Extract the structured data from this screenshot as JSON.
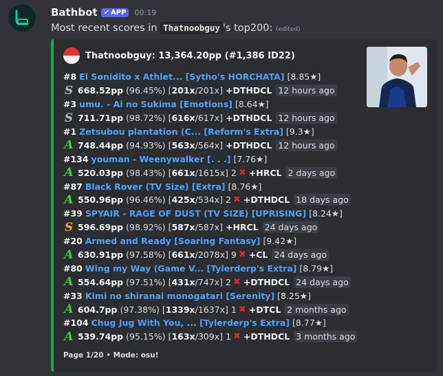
{
  "message": {
    "username": "Bathbot",
    "badge": "APP",
    "badge_check": "✔",
    "timestamp": "00:19",
    "content_prefix": "Most recent scores in ",
    "content_code": "Thatnoobguy",
    "content_suffix": "'s top200:",
    "edited": "(edited)"
  },
  "colors": {
    "embed_accent": "#1fa84a",
    "link": "#4aa3ff",
    "grade_S": "#b6b6c6",
    "grade_A": "#3ccf3c",
    "grade_S_gold": "#f2a43c",
    "miss": "#e5232b"
  },
  "embed": {
    "author": "Thatnoobguy: 13,364.20pp (#1,386 ID22)",
    "flag_icon": "indonesia-flag-icon",
    "footer": "Page 1/20 • Mode: osu!",
    "scores": [
      {
        "rank": "#8",
        "map": "El Sonidito x Athlet... [Sytho's HORCHATA]",
        "stars": "[8.85★]",
        "grade": "S",
        "grade_style": "silver",
        "pp": "668.52pp",
        "acc": "(96.45%)",
        "combo": "201x",
        "max_combo": "/201x]",
        "misses": "",
        "mods": "+DTHDCL",
        "ago": "12 hours ago"
      },
      {
        "rank": "#3",
        "map": "umu. - Ai no Sukima [Emotions]",
        "stars": "[8.64★]",
        "grade": "S",
        "grade_style": "silver",
        "pp": "711.71pp",
        "acc": "(98.72%)",
        "combo": "616x",
        "max_combo": "/617x]",
        "misses": "",
        "mods": "+DTHDCL",
        "ago": "12 hours ago"
      },
      {
        "rank": "#1",
        "map": "Zetsubou plantation (C... [Reform's Extra]",
        "stars": "[9.3★]",
        "grade": "A",
        "grade_style": "green",
        "pp": "748.44pp",
        "acc": "(94.93%)",
        "combo": "563x",
        "max_combo": "/564x]",
        "misses": "",
        "mods": "+DTHDCL",
        "ago": "12 hours ago"
      },
      {
        "rank": "#134",
        "map": "youman - Weenywalker [. . .]",
        "stars": "[7.76★]",
        "grade": "A",
        "grade_style": "green",
        "pp": "520.03pp",
        "acc": "(98.43%)",
        "combo": "661x",
        "max_combo": "/1615x]",
        "misses": "2",
        "mods": "+HRCL",
        "ago": "2 days ago"
      },
      {
        "rank": "#87",
        "map": "Black Rover (TV Size) [Extra]",
        "stars": "[8.76★]",
        "grade": "A",
        "grade_style": "green",
        "pp": "550.96pp",
        "acc": "(96.46%)",
        "combo": "425x",
        "max_combo": "/534x]",
        "misses": "2",
        "mods": "+DTHDCL",
        "ago": "18 days ago"
      },
      {
        "rank": "#39",
        "map": "SPYAIR - RAGE OF DUST (TV SIZE) [UPRISING]",
        "stars": "[8.24★]",
        "grade": "S",
        "grade_style": "gold",
        "pp": "596.69pp",
        "acc": "(98.92%)",
        "combo": "587x",
        "max_combo": "/587x]",
        "misses": "",
        "mods": "+HRCL",
        "ago": "24 days ago"
      },
      {
        "rank": "#20",
        "map": "Armed and Ready [Soaring Fantasy]",
        "stars": "[9.42★]",
        "grade": "A",
        "grade_style": "green",
        "pp": "630.91pp",
        "acc": "(97.58%)",
        "combo": "661x",
        "max_combo": "/2078x]",
        "misses": "9",
        "mods": "+CL",
        "ago": "24 days ago"
      },
      {
        "rank": "#80",
        "map": "Wing my Way (Game V... [Tylerderp's Extra]",
        "stars": "[8.79★]",
        "grade": "A",
        "grade_style": "green",
        "pp": "554.64pp",
        "acc": "(97.51%)",
        "combo": "431x",
        "max_combo": "/747x]",
        "misses": "2",
        "mods": "+DTHDCL",
        "ago": "24 days ago"
      },
      {
        "rank": "#33",
        "map": "Kimi no shiranai monogatari [Serenity]",
        "stars": "[8.25★]",
        "grade": "A",
        "grade_style": "green",
        "pp": "604.7pp",
        "acc": "(97.38%)",
        "combo": "1339x",
        "max_combo": "/1637x]",
        "misses": "1",
        "mods": "+DTCL",
        "ago": "2 months ago"
      },
      {
        "rank": "#104",
        "map": "Chug Jug With You, ... [Tylerderp's Extra]",
        "stars": "[8.77★]",
        "grade": "A",
        "grade_style": "green",
        "pp": "539.74pp",
        "acc": "(95.15%)",
        "combo": "163x",
        "max_combo": "/309x]",
        "misses": "1",
        "mods": "+DTHDCL",
        "ago": "3 months ago"
      }
    ]
  }
}
